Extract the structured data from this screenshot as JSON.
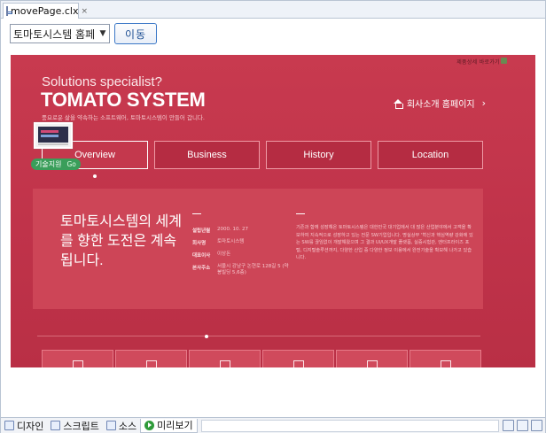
{
  "editor": {
    "tab_title": "movePage.clx",
    "tab_close": "×"
  },
  "toolbar": {
    "site_select_value": "토마토시스템 홈페",
    "go_button": "이동"
  },
  "webpage": {
    "top_link": "제품상세 바로가기",
    "kicker": "Solutions specialist?",
    "brand": "TOMATO SYSTEM",
    "tagline": "풍요로운 삶을 약속하는 소프트웨어, 토마토시스템이 만들어 갑니다.",
    "home_link": "회사소개 홈페이지",
    "menu": [
      "Overview",
      "Business",
      "History",
      "Location"
    ],
    "active_menu": "Overview",
    "widget": {
      "badge": "기술지원",
      "go": "Go"
    },
    "panel": {
      "headline": "토마토시스템의 세계를 향한 도전은 계속됩니다.",
      "facts": [
        {
          "label": "설립년월",
          "value": "2000. 10. 27"
        },
        {
          "label": "회사명",
          "value": "토마토시스템"
        },
        {
          "label": "대표이사",
          "value": "이상돈"
        },
        {
          "label": "본사주소",
          "value": "서울시 강남구 논현로 128길 5 (약봉빌딩 5,6층)"
        }
      ],
      "description": "기존과 함께 성장해온 토마토시스템은 대한민국 대기업에서 대 많은 산업분야에서 고객을 확보하여 지속적으로 성장하고 있는 전문 SW기업입니다. 명실상부 '혁신과 핵심역량 강화에 있는 SW를 끊임없이 개발해왔으며 그 결과 UI/UX개발 플랫폼, 실증시험관, 엔터프라이즈 포털, 디지털솔루션까지, 다양한 산업 중 다양한 정보 이용에서 완전기술을 확보해 나가고 있습니다."
    }
  },
  "statusbar": {
    "tabs": [
      "디자인",
      "스크립트",
      "소스",
      "미리보기"
    ],
    "active": "미리보기"
  },
  "colors": {
    "page_red": "#c2334a",
    "panel_red": "#cd4557",
    "button_blue": "#3b78c7",
    "badge_green": "#3a9e5a"
  }
}
